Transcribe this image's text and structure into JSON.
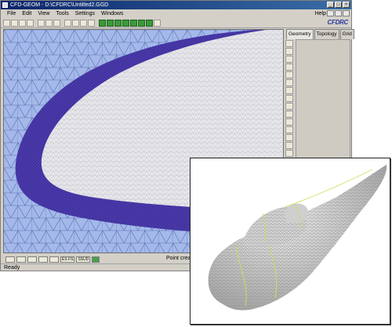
{
  "window": {
    "title": "CFD-GEOM - D:\\CFDRC\\Untitled2.GGD",
    "buttons": [
      "_",
      "□",
      "×"
    ]
  },
  "menu": {
    "items": [
      "File",
      "Edit",
      "View",
      "Tools",
      "Settings",
      "Windows"
    ],
    "help": "Help"
  },
  "brand": "CFDRC",
  "panel": {
    "tabs": [
      "Geometry",
      "Topology",
      "Grid"
    ],
    "active_tab": "Geometry"
  },
  "bottom_toolbar": {
    "labels": [
      "ES FS",
      "SSUD"
    ],
    "point_status": "Point create"
  },
  "statusbar": {
    "text": "Ready"
  },
  "colors": {
    "titlebar": "#0a246a",
    "mesh_background": "#a4b9ea",
    "boundary_layer": "#4a3aa8",
    "surface_mesh": "#e8e8ec",
    "inset_highlight": "#c8e05a"
  },
  "icons": {
    "toolbar": [
      "new-icon",
      "open-icon",
      "save-icon",
      "print-icon",
      "cut-icon",
      "copy-icon",
      "paste-icon",
      "undo-icon",
      "redo-icon",
      "zoom-icon",
      "grid-icon"
    ],
    "vertical_toolbar": [
      "point-icon",
      "line-icon",
      "arc-icon",
      "curve-icon",
      "surface-icon",
      "rotate-icon",
      "zoom-icon",
      "pan-icon"
    ]
  }
}
